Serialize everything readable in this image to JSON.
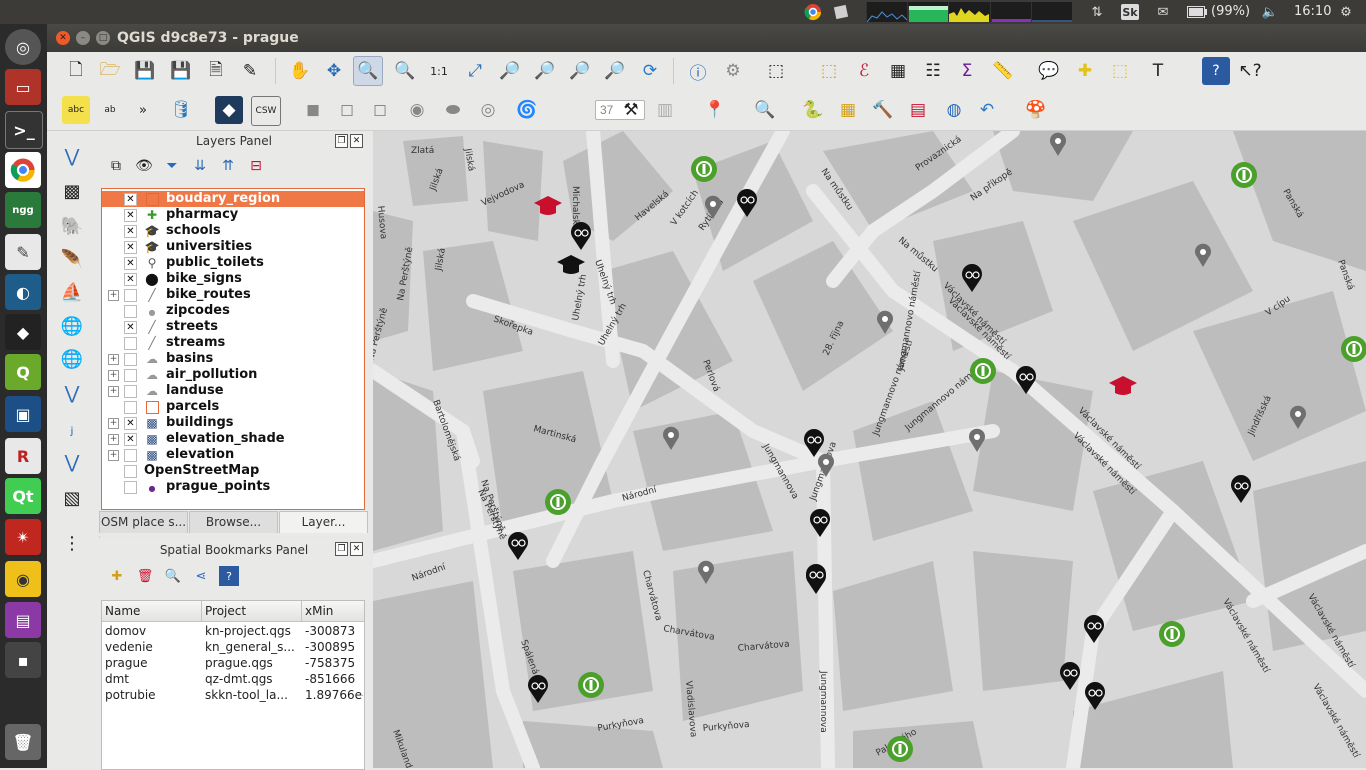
{
  "system_bar": {
    "battery": "(99%)",
    "time": "16:10",
    "keyboard": "Sk"
  },
  "window": {
    "title": "QGIS d9c8e73 - prague"
  },
  "toolbar": {
    "zoom_spin_value": "37"
  },
  "layers_panel": {
    "title": "Layers Panel",
    "layers": [
      {
        "name": "boudary_region",
        "checked": true,
        "expandable": false,
        "selected": true,
        "symbol": "square-icon"
      },
      {
        "name": "pharmacy",
        "checked": true,
        "expandable": false,
        "selected": false,
        "symbol": "pharmacy-icon"
      },
      {
        "name": "schools",
        "checked": true,
        "expandable": false,
        "selected": false,
        "symbol": "school-icon"
      },
      {
        "name": "universities",
        "checked": true,
        "expandable": false,
        "selected": false,
        "symbol": "university-icon"
      },
      {
        "name": "public_toilets",
        "checked": true,
        "expandable": false,
        "selected": false,
        "symbol": "toilet-icon"
      },
      {
        "name": "bike_signs",
        "checked": true,
        "expandable": false,
        "selected": false,
        "symbol": "bike-sign-icon"
      },
      {
        "name": "bike_routes",
        "checked": false,
        "expandable": true,
        "selected": false,
        "symbol": "line-icon"
      },
      {
        "name": "zipcodes",
        "checked": false,
        "expandable": false,
        "selected": false,
        "symbol": "dot-icon"
      },
      {
        "name": "streets",
        "checked": true,
        "expandable": false,
        "selected": false,
        "symbol": "line-icon"
      },
      {
        "name": "streams",
        "checked": false,
        "expandable": false,
        "selected": false,
        "symbol": "line-icon"
      },
      {
        "name": "basins",
        "checked": false,
        "expandable": true,
        "selected": false,
        "symbol": "polygon-icon"
      },
      {
        "name": "air_pollution",
        "checked": false,
        "expandable": true,
        "selected": false,
        "symbol": "polygon-icon"
      },
      {
        "name": "landuse",
        "checked": false,
        "expandable": true,
        "selected": false,
        "symbol": "polygon-icon"
      },
      {
        "name": "parcels",
        "checked": false,
        "expandable": false,
        "selected": false,
        "symbol": "square-icon"
      },
      {
        "name": "buildings",
        "checked": true,
        "expandable": true,
        "selected": false,
        "symbol": "raster-icon"
      },
      {
        "name": "elevation_shade",
        "checked": true,
        "expandable": true,
        "selected": false,
        "symbol": "raster-icon"
      },
      {
        "name": "elevation",
        "checked": false,
        "expandable": true,
        "selected": false,
        "symbol": "raster-icon"
      },
      {
        "name": "OpenStreetMap",
        "checked": false,
        "expandable": false,
        "selected": false,
        "symbol": "none"
      },
      {
        "name": "prague_points",
        "checked": false,
        "expandable": false,
        "selected": false,
        "symbol": "point-icon"
      }
    ],
    "tabs": [
      "OSM place s...",
      "Browse...",
      "Layer..."
    ]
  },
  "bookmarks_panel": {
    "title": "Spatial Bookmarks Panel",
    "columns": [
      "Name",
      "Project",
      "xMin"
    ],
    "rows": [
      {
        "name": "domov",
        "project": "kn-project.qgs",
        "xmin": "-300873"
      },
      {
        "name": "vedenie",
        "project": "kn_general_s...",
        "xmin": "-300895"
      },
      {
        "name": "prague",
        "project": "prague.qgs",
        "xmin": "-758375"
      },
      {
        "name": "dmt",
        "project": "qz-dmt.qgs",
        "xmin": "-851666"
      },
      {
        "name": "potrubie",
        "project": "skkn-tool_la...",
        "xmin": "1.89766e-"
      }
    ]
  },
  "map": {
    "street_labels": [
      "Zlatá",
      "Jilská",
      "Jilská",
      "Jilská",
      "Husova",
      "Vejvodova",
      "Michalská",
      "Havelská",
      "V kotcích",
      "Rytířská",
      "Na můstku",
      "Provaznická",
      "Na příkopě",
      "Panská",
      "Na můstku",
      "Václavské náměstí",
      "Panská",
      "Uhelný trh",
      "Uhelný trh",
      "Uhelný trh",
      "Na Perštýně",
      "Skořepka",
      "Na Perštýně",
      "Bartolomějská",
      "Na Perštýně",
      "Martinská",
      "Perlová",
      "28. října",
      "Jungmannovo náměstí",
      "Jungmannovo náměstí",
      "Jungmannovo náměstí",
      "Václavské náměstí",
      "Václavské náměstí",
      "Václavské náměstí",
      "V cípu",
      "Jindřišská",
      "Jungmannova",
      "Jungmannova",
      "Národní",
      "Národní",
      "Na Perštýně",
      "Charvátova",
      "Charvátova",
      "Charvátova",
      "Spálená",
      "Vladislavova",
      "Purkyňova",
      "Purkyňova",
      "Jungmannova",
      "Václavské náměstí",
      "Václavské náměstí",
      "Václavské náměstí",
      "Mikulandská",
      "Palackého"
    ]
  }
}
